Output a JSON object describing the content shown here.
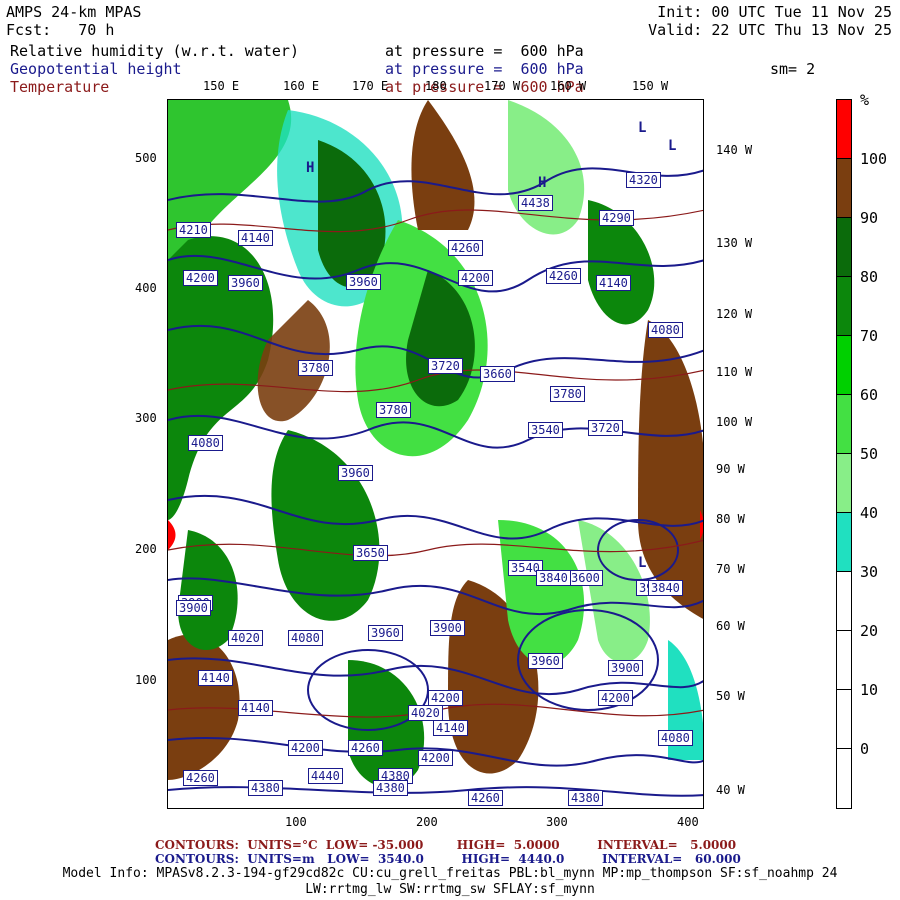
{
  "header": {
    "model": "AMPS 24-km MPAS",
    "init": "Init: 00 UTC Tue 11 Nov 25",
    "fcst": "Fcst:   70 h",
    "valid": "Valid: 22 UTC Thu 13 Nov 25",
    "sm": "sm= 2"
  },
  "fields": [
    {
      "name": "Relative humidity (w.r.t. water)",
      "level": "at pressure =  600 hPa",
      "color": "#000000"
    },
    {
      "name": "Geopotential height",
      "level": "at pressure =  600 hPa",
      "color": "#1a1a8c"
    },
    {
      "name": "Temperature",
      "level": "at pressure =  600 hPa",
      "color": "#8b1a1a"
    }
  ],
  "axes": {
    "x_ticks": [
      "100",
      "200",
      "300",
      "400"
    ],
    "y_ticks": [
      "500",
      "400",
      "300",
      "200",
      "100"
    ],
    "top_lon_labels": [
      "150 E",
      "160 E",
      "170 E",
      "180",
      "170 W",
      "160 W",
      "150 W"
    ],
    "right_lon_labels": [
      "140 W",
      "130 W",
      "120 W",
      "110 W",
      "100 W",
      "90 W",
      "80 W",
      "70 W",
      "60 W",
      "50 W",
      "40 W"
    ]
  },
  "map_labels": {
    "heights": [
      "4438",
      "4320",
      "4290",
      "4210",
      "4140",
      "4260",
      "4200",
      "4200",
      "4260",
      "4140",
      "4080",
      "3960",
      "3960",
      "3780",
      "3720",
      "3660",
      "3780",
      "3780",
      "3540",
      "3720",
      "4080",
      "3900",
      "3960",
      "3650",
      "3540",
      "3600",
      "3900",
      "3840",
      "3900",
      "3840",
      "4020",
      "4080",
      "3960",
      "3900",
      "4140",
      "3960",
      "3900",
      "4200",
      "4200",
      "4140",
      "4020",
      "4080",
      "4260",
      "4140",
      "4200",
      "4200",
      "4260",
      "4380",
      "4440",
      "4380",
      "4260",
      "4380",
      "4380"
    ],
    "marks": [
      "H",
      "L",
      "L",
      "H",
      "L"
    ]
  },
  "colorbar": {
    "unit": "%",
    "labels": [
      "100",
      "90",
      "80",
      "70",
      "60",
      "50",
      "40",
      "30",
      "20",
      "10",
      "0"
    ],
    "colors": [
      "#ff0000",
      "#7a3e10",
      "#0b6b0b",
      "#0c870c",
      "#00d000",
      "#43e043",
      "#88ee88",
      "#20e0c0",
      "#ffffff",
      "#ffffff",
      "#ffffff",
      "#ffffff"
    ]
  },
  "footer": {
    "temp_line": "CONTOURS:  UNITS=°C  LOW= -35.000        HIGH=  5.0000         INTERVAL=   5.0000",
    "hgt_line": "CONTOURS:  UNITS=m   LOW=  3540.0         HIGH=  4440.0         INTERVAL=   60.000",
    "model_info_1": "Model Info: MPASv8.2.3-194-gf29cd82c CU:cu_grell_freitas PBL:bl_mynn MP:mp_thompson SF:sf_noahmp 24",
    "model_info_2": "LW:rrtmg_lw SW:rrtmg_sw SFLAY:sf_mynn",
    "temp_color": "#8b1a1a",
    "hgt_color": "#1a1a8c"
  }
}
